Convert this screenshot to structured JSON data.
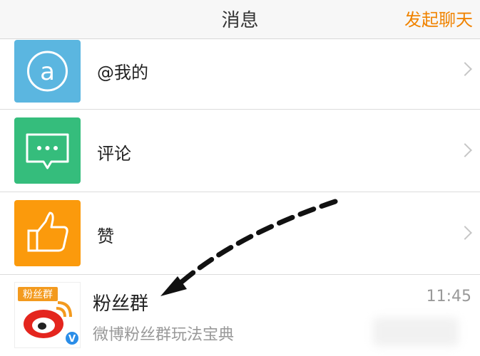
{
  "header": {
    "title": "消息",
    "action": "发起聊天"
  },
  "rows": [
    {
      "label": "@我的",
      "icon": "at-icon",
      "color": "#5bb6e0"
    },
    {
      "label": "评论",
      "icon": "comment-icon",
      "color": "#35bd7c"
    },
    {
      "label": "赞",
      "icon": "thumbs-up-icon",
      "color": "#fb9a0c"
    }
  ],
  "chat": {
    "name": "粉丝群",
    "preview": "微博粉丝群玩法宝典",
    "time": "11:45",
    "badge_text": "粉丝群",
    "verified_mark": "V"
  },
  "colors": {
    "accent": "#f08300"
  }
}
